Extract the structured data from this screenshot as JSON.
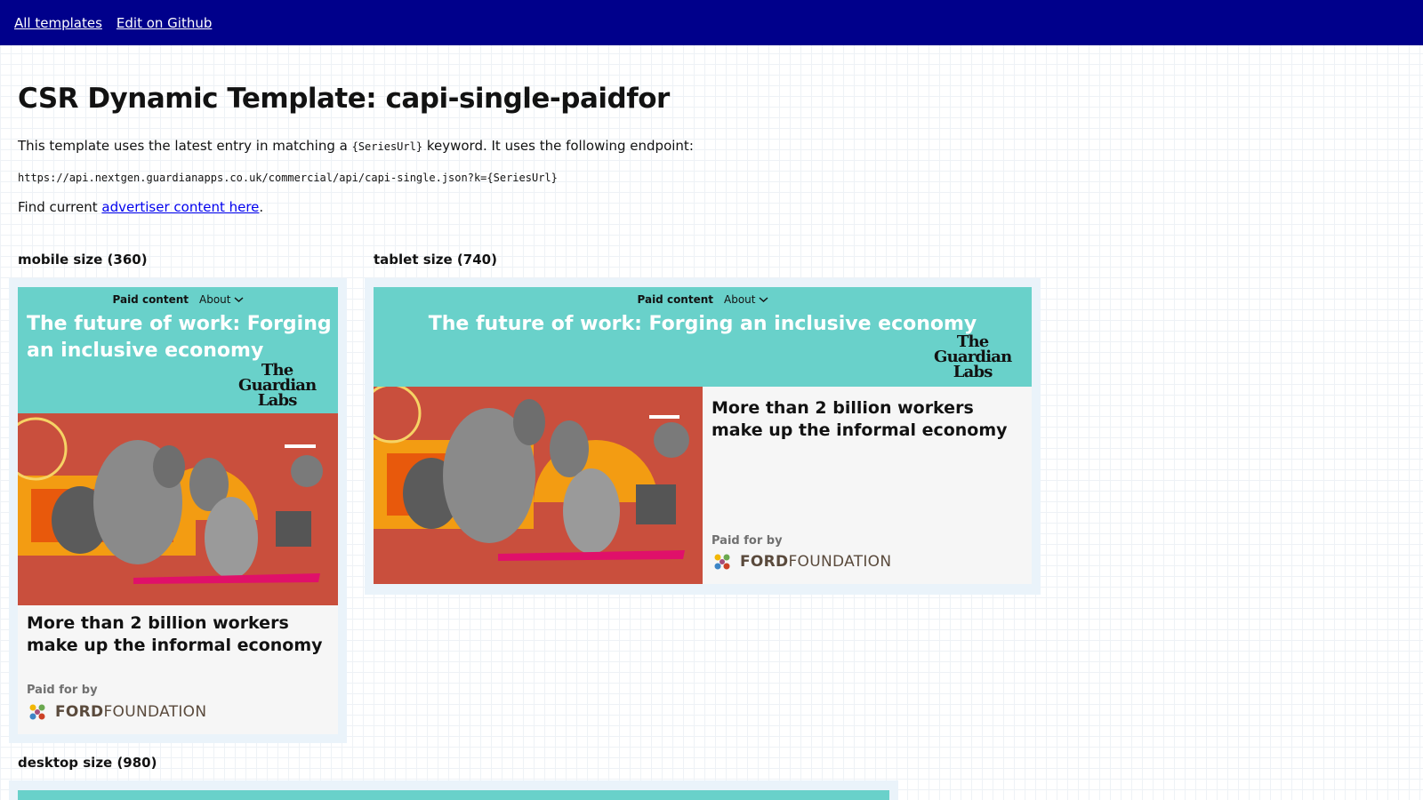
{
  "nav": {
    "all_templates": "All templates",
    "edit_github": "Edit on Github"
  },
  "page": {
    "title": "CSR Dynamic Template: capi-single-paidfor",
    "intro_before": "This template uses the latest entry in matching a ",
    "intro_code": "{SeriesUrl}",
    "intro_after": " keyword. It uses the following endpoint:",
    "endpoint": "https://api.nextgen.guardianapps.co.uk/commercial/api/capi-single.json?k={SeriesUrl}",
    "find_before": "Find current ",
    "find_link": "advertiser content here",
    "find_after": "."
  },
  "sizes": {
    "mobile": "mobile size (360)",
    "tablet": "tablet size (740)",
    "desktop": "desktop size (980)"
  },
  "ad": {
    "paid_label": "Paid content",
    "about_label": "About",
    "title": "The future of work: Forging an inclusive economy",
    "logo_line1": "The",
    "logo_line2": "Guardian",
    "logo_line3": "Labs",
    "headline": "More than 2 billion workers make up the informal economy",
    "paid_by": "Paid for by",
    "sponsor_bold": "FORD",
    "sponsor_rest": "FOUNDATION"
  },
  "colors": {
    "topbar": "#00008b",
    "ad_header": "#69d1ca",
    "hero_bg": "#c94f3d"
  }
}
